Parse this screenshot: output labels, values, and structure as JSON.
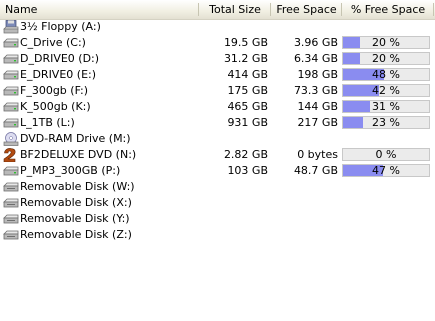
{
  "columns": {
    "name": "Name",
    "total": "Total Size",
    "free": "Free Space",
    "pct": "% Free Space"
  },
  "drives": [
    {
      "name": "3½ Floppy (A:)",
      "icon": "floppy-icon",
      "total": "",
      "free": "",
      "pct_label": "",
      "pct": null
    },
    {
      "name": "C_Drive (C:)",
      "icon": "hard-drive-icon",
      "total": "19.5 GB",
      "free": "3.96 GB",
      "pct_label": "20 %",
      "pct": 20
    },
    {
      "name": "D_DRIVE0 (D:)",
      "icon": "hard-drive-icon",
      "total": "31.2 GB",
      "free": "6.34 GB",
      "pct_label": "20 %",
      "pct": 20
    },
    {
      "name": "E_DRIVE0 (E:)",
      "icon": "hard-drive-icon",
      "total": "414 GB",
      "free": "198 GB",
      "pct_label": "48 %",
      "pct": 48
    },
    {
      "name": "F_300gb (F:)",
      "icon": "hard-drive-icon",
      "total": "175 GB",
      "free": "73.3 GB",
      "pct_label": "42 %",
      "pct": 42
    },
    {
      "name": "K_500gb (K:)",
      "icon": "hard-drive-icon",
      "total": "465 GB",
      "free": "144 GB",
      "pct_label": "31 %",
      "pct": 31
    },
    {
      "name": "L_1TB (L:)",
      "icon": "hard-drive-icon",
      "total": "931 GB",
      "free": "217 GB",
      "pct_label": "23 %",
      "pct": 23
    },
    {
      "name": "DVD-RAM Drive (M:)",
      "icon": "optical-drive-icon",
      "total": "",
      "free": "",
      "pct_label": "",
      "pct": null
    },
    {
      "name": "BF2DELUXE DVD (N:)",
      "icon": "dvd-disc-icon",
      "total": "2.82 GB",
      "free": "0 bytes",
      "pct_label": "0 %",
      "pct": 0
    },
    {
      "name": "P_MP3_300GB (P:)",
      "icon": "hard-drive-icon",
      "total": "103 GB",
      "free": "48.7 GB",
      "pct_label": "47 %",
      "pct": 47
    },
    {
      "name": "Removable Disk (W:)",
      "icon": "removable-disk-icon",
      "total": "",
      "free": "",
      "pct_label": "",
      "pct": null
    },
    {
      "name": "Removable Disk (X:)",
      "icon": "removable-disk-icon",
      "total": "",
      "free": "",
      "pct_label": "",
      "pct": null
    },
    {
      "name": "Removable Disk (Y:)",
      "icon": "removable-disk-icon",
      "total": "",
      "free": "",
      "pct_label": "",
      "pct": null
    },
    {
      "name": "Removable Disk (Z:)",
      "icon": "removable-disk-icon",
      "total": "",
      "free": "",
      "pct_label": "",
      "pct": null
    }
  ],
  "colors": {
    "bar_fill": "#8a8cf0",
    "bar_track": "#ebebeb",
    "header_bg": "#ece9d8"
  }
}
